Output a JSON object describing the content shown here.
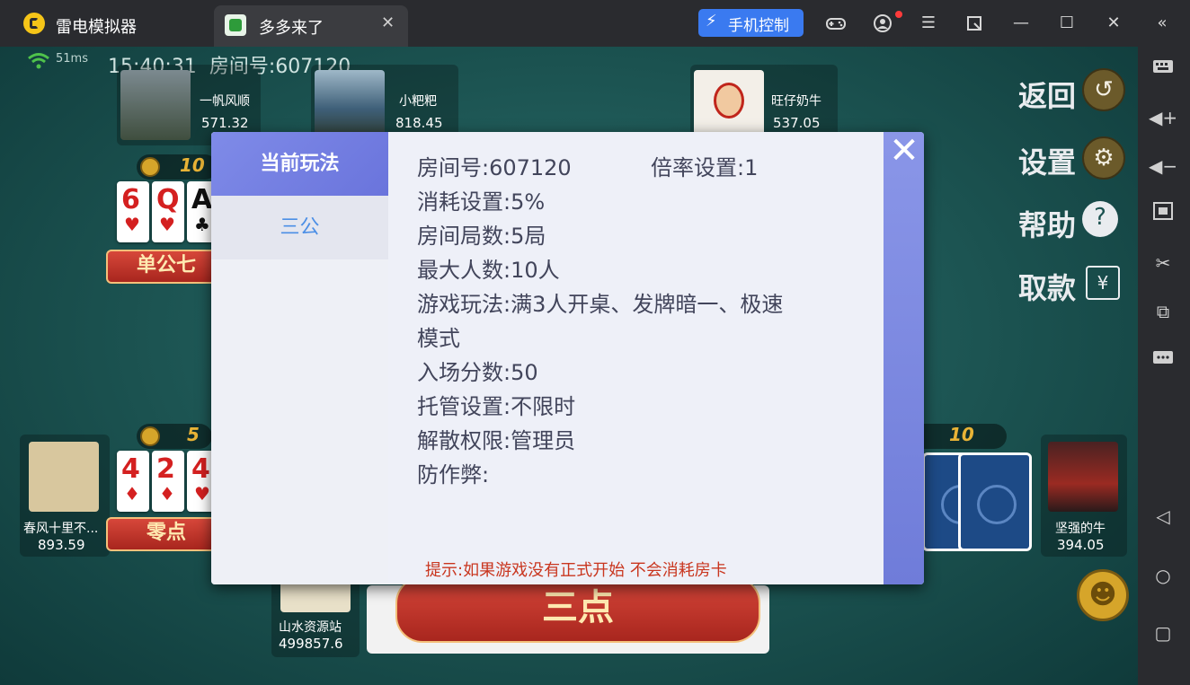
{
  "emulator": {
    "app_name": "雷电模拟器",
    "tab_title": "多多来了",
    "phone_control_label": "手机控制",
    "icons": [
      "gamepad-icon",
      "account-icon",
      "menu-icon",
      "expand-icon",
      "minimize-icon",
      "maximize-icon",
      "close-icon",
      "collapse-sidebar-icon"
    ],
    "sidebar_icons": [
      "keyboard-icon",
      "volume-up-icon",
      "volume-down-icon",
      "screenshot-icon",
      "cut-icon",
      "multi-window-icon",
      "more-icon",
      "back-nav-icon",
      "home-nav-icon",
      "recents-nav-icon"
    ]
  },
  "game": {
    "latency": "51ms",
    "time": "15:40:31",
    "room_label": "房间号:",
    "room_number": "607120",
    "players": [
      {
        "name": "一帆风顺",
        "score": "571.32"
      },
      {
        "name": "小粑粑",
        "score": "818.45"
      },
      {
        "name": "旺仔奶牛",
        "score": "537.05"
      },
      {
        "name": "春风十里不...",
        "score": "893.59"
      },
      {
        "name": "坚强的牛",
        "score": "394.05"
      },
      {
        "name": "山水资源站",
        "score": "499857.6"
      }
    ],
    "bets": {
      "top_left": "10",
      "mid_left": "5",
      "right": "10"
    },
    "hand_top": {
      "cards": [
        {
          "rank": "6",
          "suit": "♥"
        },
        {
          "rank": "Q",
          "suit": "♥"
        },
        {
          "rank": "A",
          "suit": "♣"
        }
      ],
      "result": "单公七"
    },
    "hand_left": {
      "cards": [
        {
          "rank": "4",
          "suit": "♦"
        },
        {
          "rank": "2",
          "suit": "♦"
        },
        {
          "rank": "4",
          "suit": "♥"
        }
      ],
      "result": "零点"
    },
    "hand_bottom": {
      "result": "三点"
    },
    "menu": {
      "back": "返回",
      "settings": "设置",
      "help": "帮助",
      "withdraw": "取款"
    }
  },
  "modal": {
    "tab_current": "当前玩法",
    "tab_game": "三公",
    "info": {
      "room_no": "房间号:607120",
      "multiplier": "倍率设置:1",
      "consumption": "消耗设置:5%",
      "rounds": "房间局数:5局",
      "max_players": "最大人数:10人",
      "rules_line1": "游戏玩法:满3人开桌、发牌暗一、极速",
      "rules_line2": "模式",
      "entry_score": "入场分数:50",
      "auto_play": "托管设置:不限时",
      "dissolve": "解散权限:管理员",
      "anti_cheat": "防作弊:"
    },
    "tip": "提示:如果游戏没有正式开始 不会消耗房卡"
  }
}
